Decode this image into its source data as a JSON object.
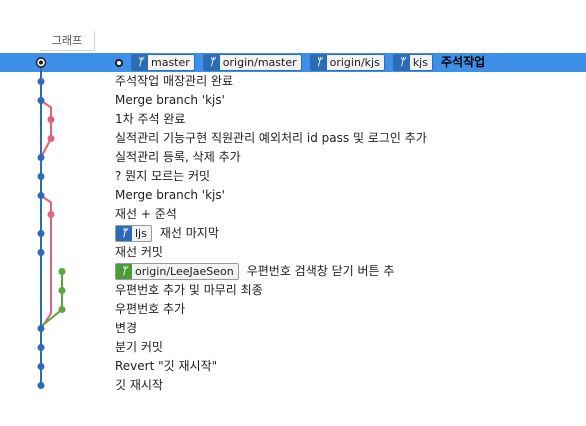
{
  "header": {
    "graph_label": "그래프"
  },
  "commits": [
    {
      "message": "주석작업",
      "selected": true,
      "current": true,
      "refs": [
        {
          "label": "master",
          "kind": "branch"
        },
        {
          "label": "origin/master",
          "kind": "branch"
        },
        {
          "label": "origin/kjs",
          "kind": "branch"
        },
        {
          "label": "kjs",
          "kind": "branch"
        }
      ]
    },
    {
      "message": "주석작업 매장관리 완료",
      "refs": []
    },
    {
      "message": "Merge branch 'kjs'",
      "refs": []
    },
    {
      "message": "1차 주석 완료",
      "refs": []
    },
    {
      "message": "실적관리 기능구현 직원관리 예외처리 id pass 및 로그인 추가",
      "refs": []
    },
    {
      "message": "실적관리 등록, 삭제 추가",
      "refs": []
    },
    {
      "message": "? 뭔지 모르는 커밋",
      "refs": []
    },
    {
      "message": "Merge branch 'kjs'",
      "refs": []
    },
    {
      "message": "재선 + 준석",
      "refs": []
    },
    {
      "message": "재선 마지막",
      "refs": [
        {
          "label": "ljs",
          "kind": "branch"
        }
      ]
    },
    {
      "message": "재선 커밋",
      "refs": []
    },
    {
      "message": "우편번호 검색창 닫기 버튼 추",
      "refs": [
        {
          "label": "origin/LeeJaeSeon",
          "kind": "remote-green"
        }
      ]
    },
    {
      "message": "우편번호 추가 및 마무리 최종",
      "refs": []
    },
    {
      "message": "우편번호 추가",
      "refs": []
    },
    {
      "message": "변경",
      "refs": []
    },
    {
      "message": "분기 커밋",
      "refs": []
    },
    {
      "message": "Revert \"깃 재시작\"",
      "refs": []
    },
    {
      "message": "깃 재시작",
      "refs": []
    }
  ],
  "colors": {
    "selection": "#3d8fe8",
    "lane_main": "#2d6bb6",
    "lane_pink": "#e0637a",
    "lane_green": "#5aa73d"
  }
}
